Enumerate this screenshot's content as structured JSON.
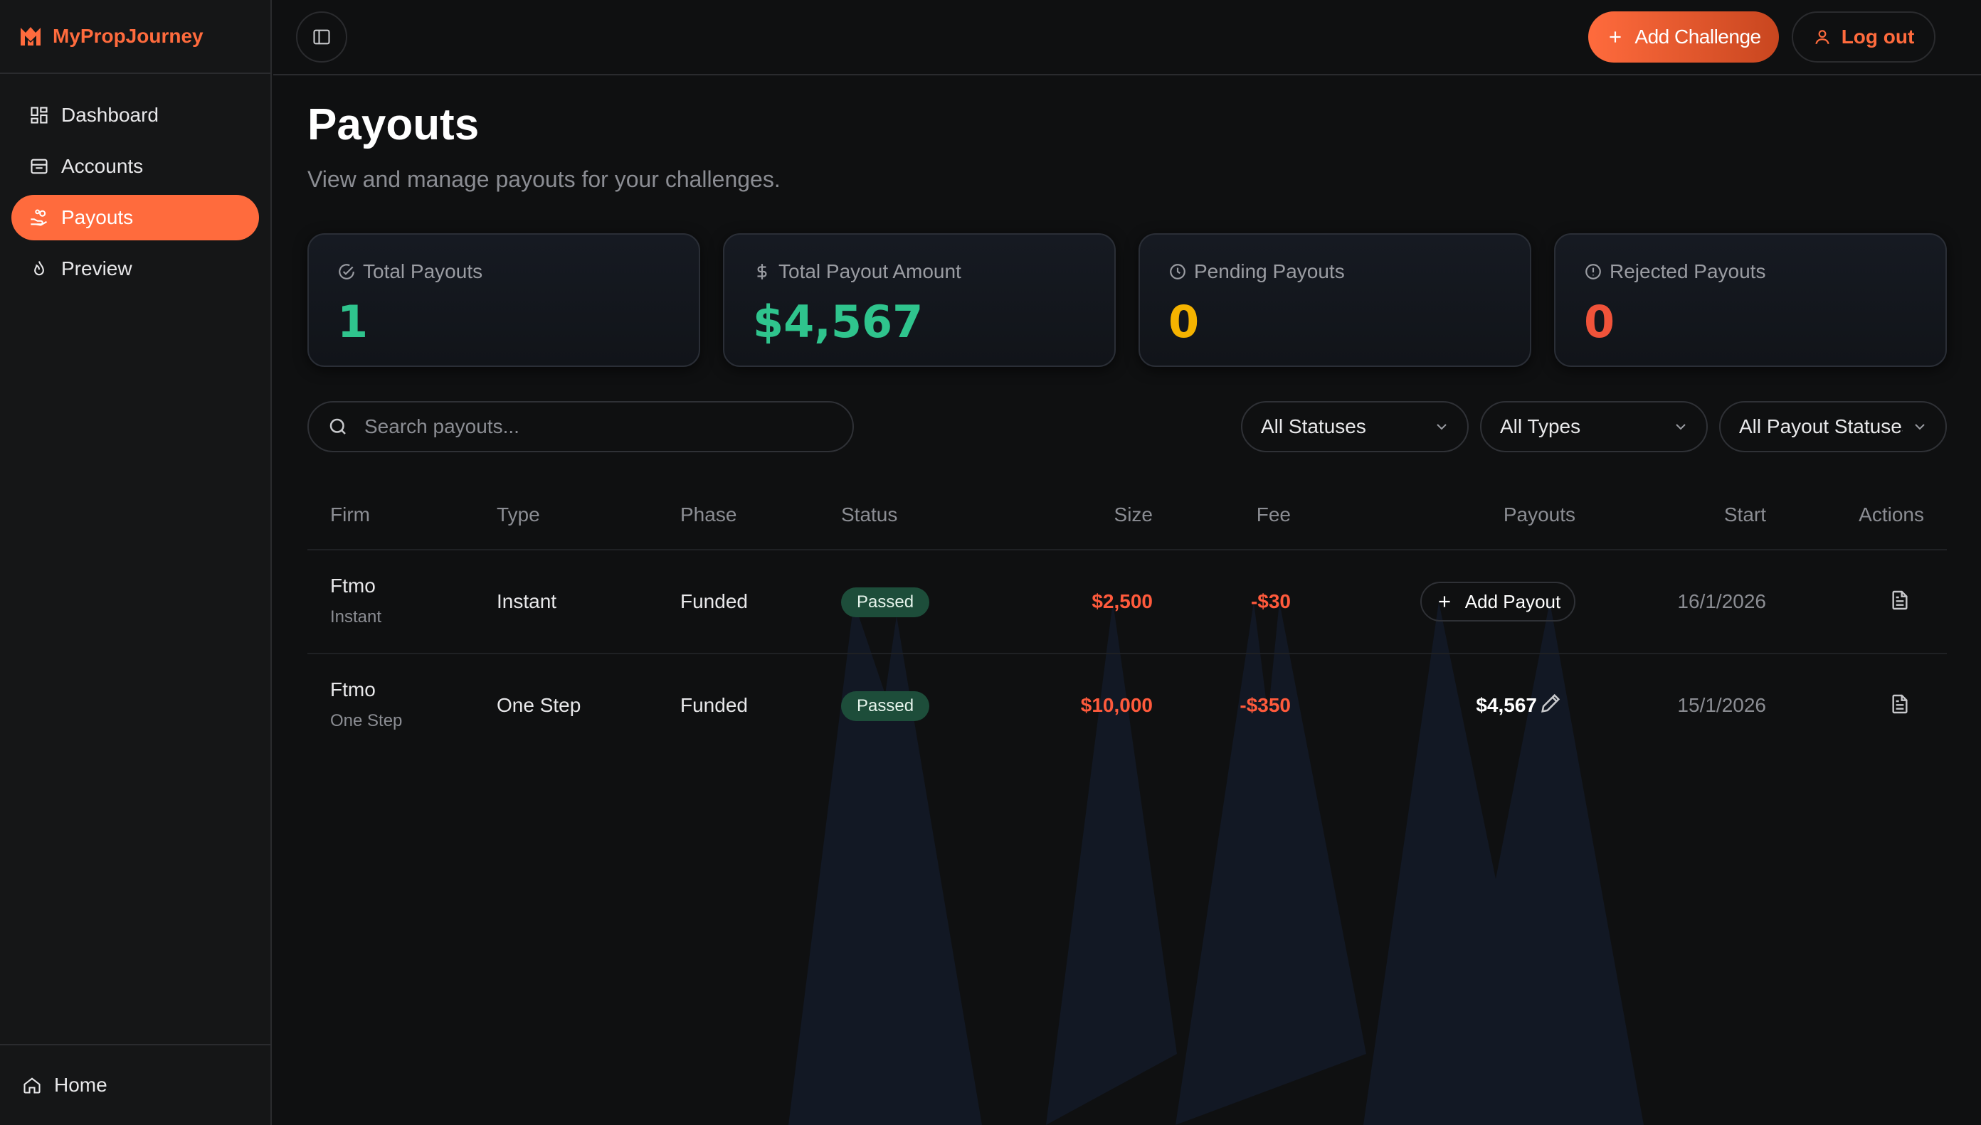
{
  "brand": {
    "name": "MyPropJourney",
    "color": "#ff6b3d"
  },
  "sidebar": {
    "items": [
      {
        "label": "Dashboard",
        "icon": "dashboard-grid-icon",
        "active": false
      },
      {
        "label": "Accounts",
        "icon": "inbox-icon",
        "active": false
      },
      {
        "label": "Payouts",
        "icon": "hand-coins-icon",
        "active": true
      },
      {
        "label": "Preview",
        "icon": "flame-icon",
        "active": false
      }
    ],
    "footer": {
      "label": "Home",
      "icon": "home-icon"
    }
  },
  "topbar": {
    "add_challenge_label": "Add Challenge",
    "logout_label": "Log out"
  },
  "page": {
    "title": "Payouts",
    "subtitle": "View and manage payouts for your challenges."
  },
  "stats": [
    {
      "label": "Total Payouts",
      "value": "1",
      "icon": "check-circle-icon",
      "color": "#2fc48d"
    },
    {
      "label": "Total Payout Amount",
      "value": "$4,567",
      "icon": "dollar-icon",
      "color": "#2fc48d"
    },
    {
      "label": "Pending Payouts",
      "value": "0",
      "icon": "clock-icon",
      "color": "#f5b300"
    },
    {
      "label": "Rejected Payouts",
      "value": "0",
      "icon": "alert-circle-icon",
      "color": "#f0533a"
    }
  ],
  "filters": {
    "search_placeholder": "Search payouts...",
    "status": "All Statuses",
    "type": "All Types",
    "payout_status": "All Payout Statuses"
  },
  "table": {
    "headers": [
      "Firm",
      "Type",
      "Phase",
      "Status",
      "Size",
      "Fee",
      "Payouts",
      "Start",
      "Actions"
    ],
    "rows": [
      {
        "firm": "Ftmo",
        "firm_sub": "Instant",
        "type": "Instant",
        "phase": "Funded",
        "status": "Passed",
        "size": "$2,500",
        "fee": "-$30",
        "payout_action": "Add Payout",
        "start": "16/1/2026"
      },
      {
        "firm": "Ftmo",
        "firm_sub": "One Step",
        "type": "One Step",
        "phase": "Funded",
        "status": "Passed",
        "size": "$10,000",
        "fee": "-$350",
        "payout_amount": "$4,567",
        "start": "15/1/2026"
      }
    ]
  }
}
